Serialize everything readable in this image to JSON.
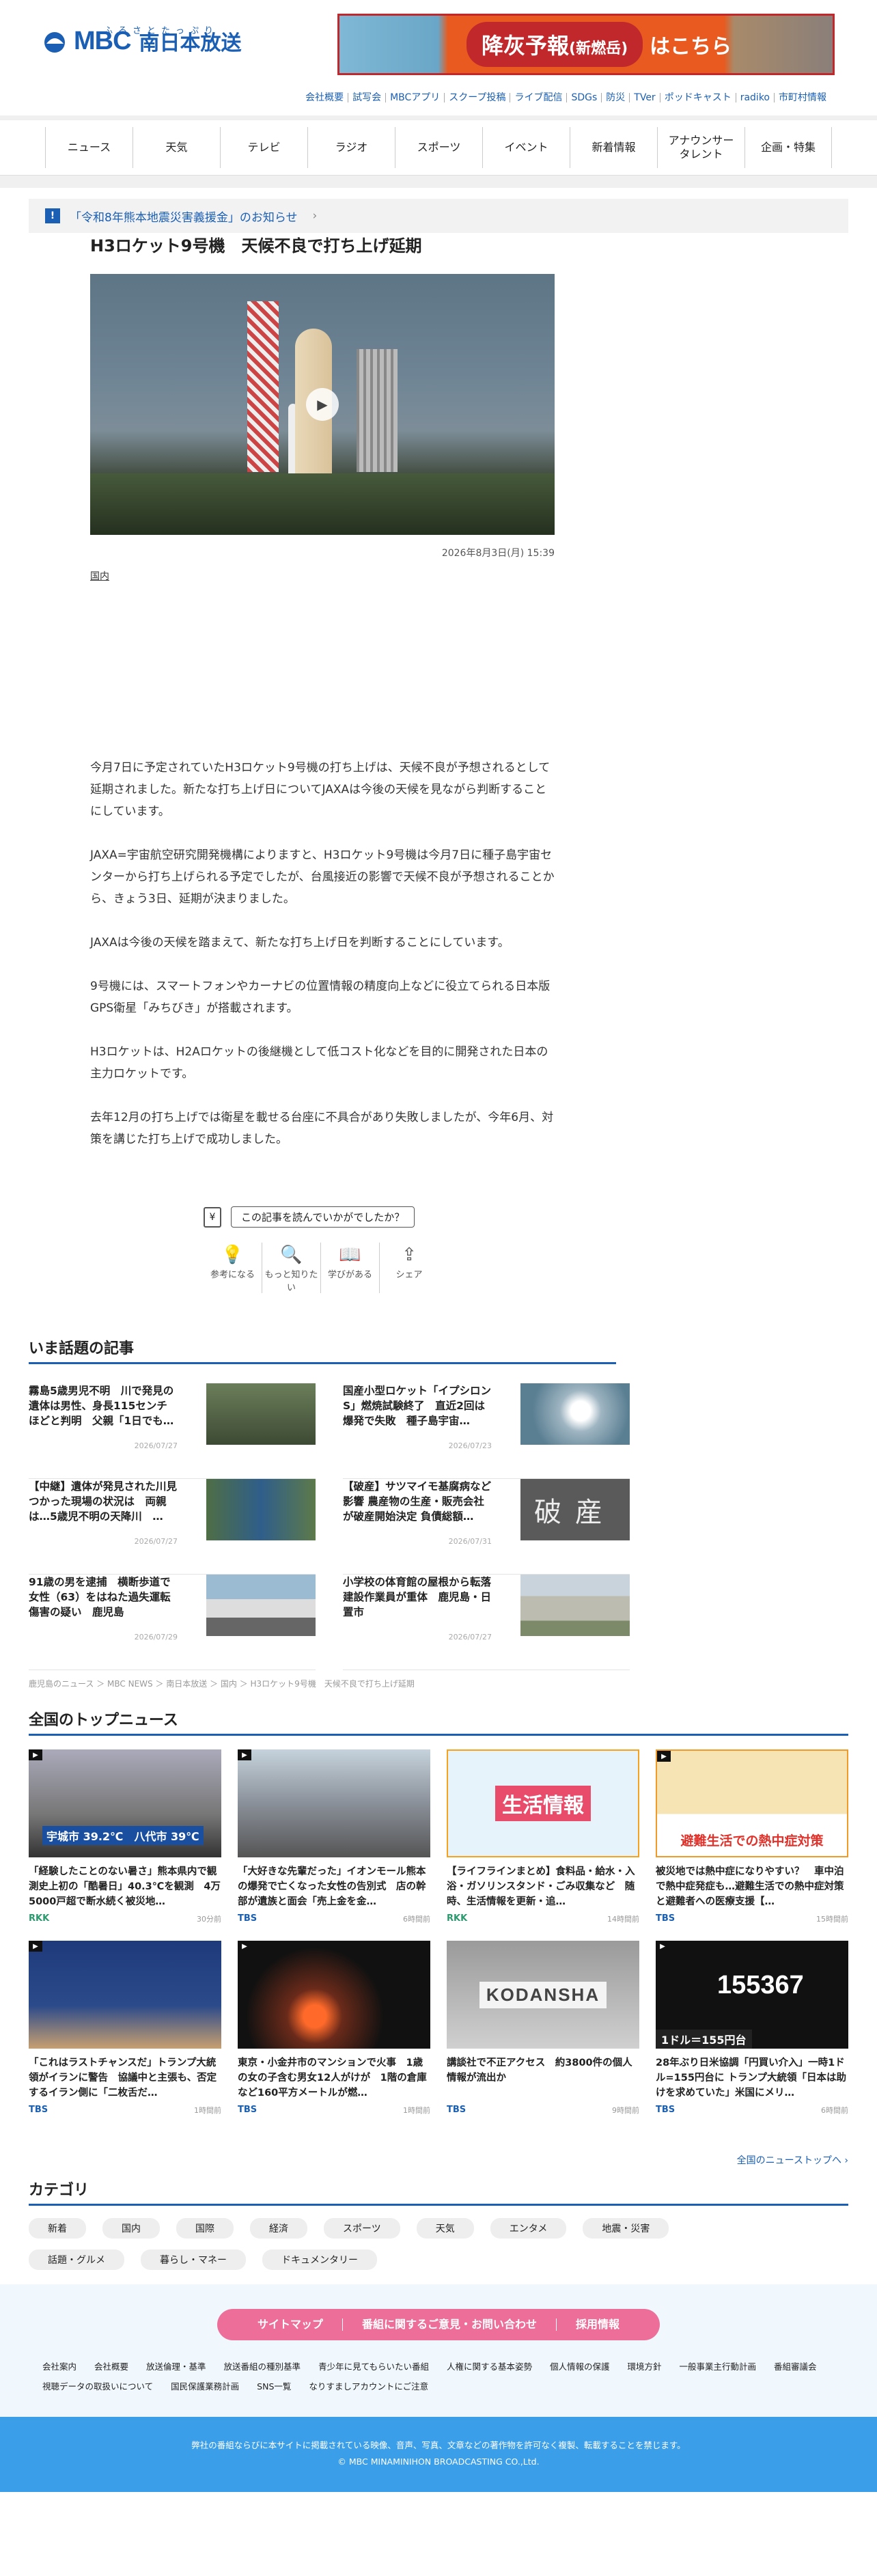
{
  "header": {
    "logo_ruby": "ふるさとたっぷり",
    "logo_mbc": "MBC",
    "logo_name": "南日本放送",
    "banner_pill": "降灰予報",
    "banner_pill_small": "(新燃岳)",
    "banner_text": "はこちら",
    "top_links": [
      "会社概要",
      "試写会",
      "MBCアプリ",
      "スクープ投稿",
      "ライブ配信",
      "SDGs",
      "防災",
      "TVer",
      "ポッドキャスト",
      "radiko",
      "市町村情報"
    ]
  },
  "nav": [
    "ニュース",
    "天気",
    "テレビ",
    "ラジオ",
    "スポーツ",
    "イベント",
    "新着情報",
    "アナウンサー\nタレント",
    "企画・特集"
  ],
  "notice": {
    "mark": "!",
    "text": "「令和8年熊本地震災害義援金」のお知らせ",
    "chev": "›"
  },
  "article": {
    "title": "H3ロケット9号機　天候不良で打ち上げ延期",
    "date": "2026年8月3日(月) 15:39",
    "category": "国内",
    "paragraphs": [
      "今月7日に予定されていたH3ロケット9号機の打ち上げは、天候不良が予想されるとして延期されました。新たな打ち上げ日についてJAXAは今後の天候を見ながら判断することにしています。",
      "JAXA=宇宙航空研究開発機構によりますと、H3ロケット9号機は今月7日に種子島宇宙センターから打ち上げられる予定でしたが、台風接近の影響で天候不良が予想されることから、きょう3日、延期が決まりました。",
      "JAXAは今後の天候を踏まえて、新たな打ち上げ日を判断することにしています。",
      "9号機には、スマートフォンやカーナビの位置情報の精度向上などに役立てられる日本版GPS衛星「みちびき」が搭載されます。",
      "H3ロケットは、H2Aロケットの後継機として低コスト化などを目的に開発された日本の主力ロケットです。",
      "去年12月の打ち上げでは衛星を載せる台座に不具合があり失敗しましたが、今年6月、対策を講じた打ち上げで成功しました。"
    ]
  },
  "feedback": {
    "question": "この記事を読んでいかがでしたか？",
    "buttons": [
      {
        "label": "参考になる",
        "icon": "💡"
      },
      {
        "label": "もっと知りたい",
        "icon": "🔍"
      },
      {
        "label": "学びがある",
        "icon": "📖"
      },
      {
        "label": "シェア",
        "icon": "⇪"
      }
    ]
  },
  "hot": {
    "title": "いま話題の記事",
    "items": [
      {
        "title": "霧島5歳男児不明　川で発見の遺体は男性、身長115センチほどと判明　父親「1日でも…",
        "date": "2026/07/27"
      },
      {
        "title": "国産小型ロケット「イプシロンS」燃焼試験終了　直近2回は爆発で失敗　種子島宇宙…",
        "date": "2026/07/23"
      },
      {
        "title": "【中継】遺体が発見された川見つかった現場の状況は　両親は…5歳児不明の天降川　…",
        "date": "2026/07/27"
      },
      {
        "title": "【破産】サツマイモ基腐病など影響 農産物の生産・販売会社が破産開始決定 負債総額…",
        "date": "2026/07/31"
      },
      {
        "title": "91歳の男を逮捕　横断歩道で女性（63）をはねた過失運転傷害の疑い　鹿児島",
        "date": "2026/07/29"
      },
      {
        "title": "小学校の体育館の屋根から転落　建設作業員が重体　鹿児島・日置市",
        "date": "2026/07/27"
      }
    ]
  },
  "breadcrumb": "鹿児島のニュース ＞ MBC NEWS ＞ 南日本放送 ＞ 国内 ＞ H3ロケット9号機　天候不良で打ち上げ延期",
  "national": {
    "title": "全国のトップニュース",
    "more": "全国のニューストップへ ›",
    "items": [
      {
        "title": "「経験したことのない暑さ」熊本県内で観測史上初の「酷暑日」40.3℃を観測　4万5000戸超で断水続く被災地…",
        "src": "RKK",
        "time": "30分前",
        "src_color": "#2c9a6f"
      },
      {
        "title": "「大好きな先輩だった」イオンモール熊本の爆発で亡くなった女性の告別式　店の幹部が遺族と面会「売上金を金…",
        "src": "TBS",
        "time": "6時間前",
        "src_color": "#1a5fb4"
      },
      {
        "title": "【ライフラインまとめ】食料品・給水・入浴・ガソリンスタンド・ごみ収集など　随時、生活情報を更新・追…",
        "src": "RKK",
        "time": "14時間前",
        "src_color": "#2c9a6f"
      },
      {
        "title": "被災地では熱中症になりやすい？　車中泊で熱中症発症も…避難生活での熱中症対策と避難者への医療支援【…",
        "src": "TBS",
        "time": "15時間前",
        "src_color": "#1a5fb4"
      },
      {
        "title": "「これはラストチャンスだ」トランプ大統領がイランに警告　協議中と主張も、否定するイラン側に「二枚舌だ…",
        "src": "TBS",
        "time": "1時間前",
        "src_color": "#1a5fb4"
      },
      {
        "title": "東京・小金井市のマンションで火事　1歳の女の子含む男女12人がけが　1階の倉庫など160平方メートルが燃…",
        "src": "TBS",
        "time": "1時間前",
        "src_color": "#1a5fb4"
      },
      {
        "title": "講談社で不正アクセス　約3800件の個人情報が流出か",
        "src": "TBS",
        "time": "9時間前",
        "src_color": "#1a5fb4"
      },
      {
        "title": "28年ぶり日米協調「円買い介入」一時1ドル=155円台に トランプ大統領「日本は助けを求めていた」米国にメリ…",
        "src": "TBS",
        "time": "6時間前",
        "src_color": "#1a5fb4"
      }
    ],
    "thumb_texts": {
      "t1a": "宇城市 39.2℃",
      "t1b": "八代市 39℃",
      "t3": "生活情報",
      "t4": "避難生活での熱中症対策",
      "t7": "KODANSHA",
      "t8a": "155367",
      "t8b": "1ドル＝155円台"
    }
  },
  "categories": {
    "title": "カテゴリ",
    "chips": [
      "新着",
      "国内",
      "国際",
      "経済",
      "スポーツ",
      "天気",
      "エンタメ",
      "地震・災害",
      "話題・グルメ",
      "暮らし・マネー",
      "ドキュメンタリー"
    ]
  },
  "footer": {
    "pink": [
      "サイトマップ",
      "番組に関するご意見・お問い合わせ",
      "採用情報"
    ],
    "links": [
      "会社案内",
      "会社概要",
      "放送倫理・基準",
      "放送番組の種別基準",
      "青少年に見てもらいたい番組",
      "人権に関する基本姿勢",
      "個人情報の保護",
      "環境方針",
      "一般事業主行動計画",
      "番組審議会",
      "視聴データの取扱いについて",
      "国民保護業務計画",
      "SNS一覧",
      "なりすましアカウントにご注意"
    ],
    "notice": "弊社の番組ならびに本サイトに掲載されている映像、音声、写真、文章などの著作物を許可なく複製、転載することを禁じます。",
    "copyright": "© MBC MINAMINIHON BROADCASTING CO.,Ltd."
  }
}
